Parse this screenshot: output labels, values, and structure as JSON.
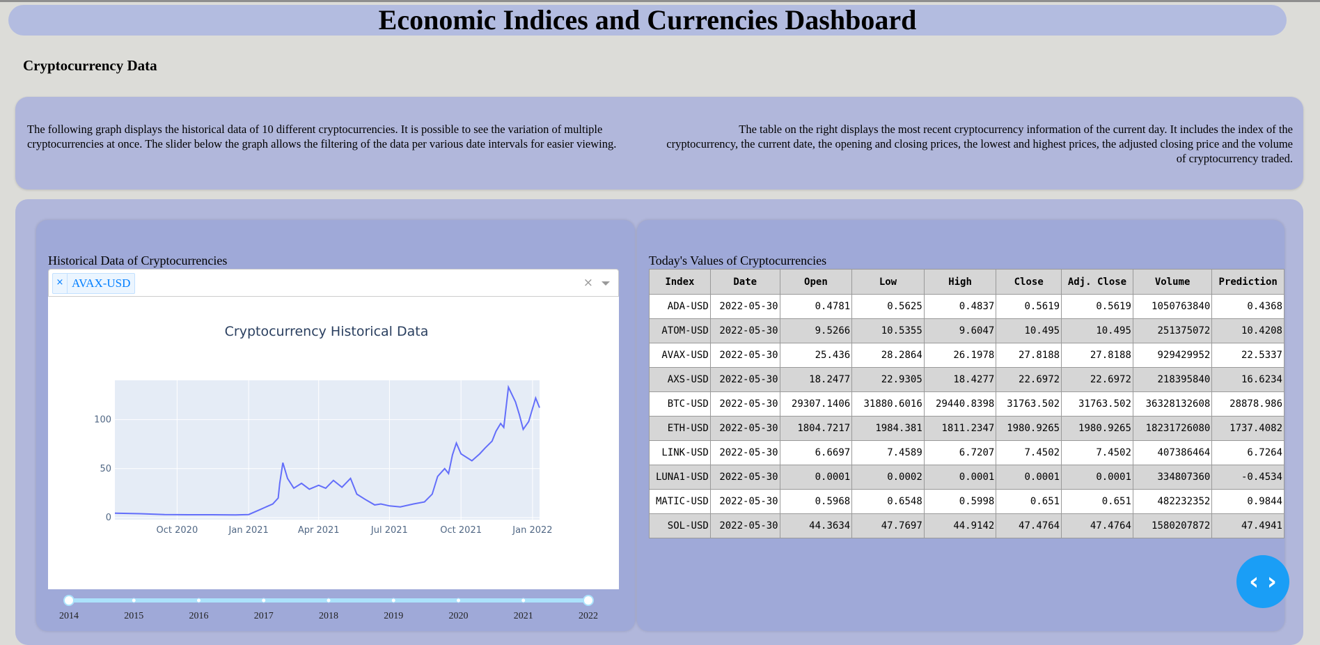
{
  "header": {
    "title": "Economic Indices and Currencies Dashboard"
  },
  "section": {
    "title": "Cryptocurrency Data"
  },
  "description": {
    "left": "The following graph displays the historical data of 10 different cryptocurrencies. It is possible to see the variation of multiple cryptocurrencies at once. The slider below the graph allows the filtering of the data per various date intervals for easier viewing.",
    "right": "The table on the right displays the most recent cryptocurrency information of the current day. It includes the index of the cryptocurrency, the current date, the opening and closing prices, the lowest and highest prices, the adjusted closing price and the volume of cryptocurrency traded."
  },
  "historical": {
    "title": "Historical Data of Cryptocurrencies",
    "dropdown": {
      "selected": [
        "AVAX-USD"
      ],
      "remove_glyph": "×",
      "clear_glyph": "×"
    }
  },
  "chart_data": {
    "type": "line",
    "title": "Cryptocurrency Historical Data",
    "xlabel": "",
    "ylabel": "",
    "x_ticks": [
      "Oct 2020",
      "Jan 2021",
      "Apr 2021",
      "Jul 2021",
      "Oct 2021",
      "Jan 2022"
    ],
    "y_ticks": [
      0,
      50,
      100
    ],
    "xlim": [
      "2020-07-13",
      "2022-01-10"
    ],
    "ylim": [
      -2,
      140
    ],
    "grid": true,
    "color": "#636efa",
    "series": [
      {
        "x": [
          "2020-07-13",
          "2020-08-15",
          "2020-09-15",
          "2020-10-15",
          "2020-11-15",
          "2020-12-15",
          "2021-01-01",
          "2021-01-15",
          "2021-02-01",
          "2021-02-08",
          "2021-02-10",
          "2021-02-14",
          "2021-02-20",
          "2021-02-28",
          "2021-03-10",
          "2021-03-20",
          "2021-04-01",
          "2021-04-10",
          "2021-04-20",
          "2021-05-01",
          "2021-05-12",
          "2021-05-20",
          "2021-06-01",
          "2021-06-12",
          "2021-06-20",
          "2021-07-01",
          "2021-07-15",
          "2021-08-01",
          "2021-08-15",
          "2021-08-25",
          "2021-09-01",
          "2021-09-10",
          "2021-09-15",
          "2021-09-20",
          "2021-09-25",
          "2021-10-01",
          "2021-10-15",
          "2021-10-25",
          "2021-11-01",
          "2021-11-10",
          "2021-11-15",
          "2021-11-21",
          "2021-11-25",
          "2021-12-01",
          "2021-12-10",
          "2021-12-15",
          "2021-12-20",
          "2021-12-27",
          "2022-01-05",
          "2022-01-10"
        ],
        "y": [
          4.5,
          4.0,
          3.2,
          3.0,
          3.0,
          2.8,
          3.2,
          8.0,
          14.0,
          20.0,
          35.0,
          56.0,
          40.0,
          30.0,
          35.0,
          29.0,
          33.0,
          30.0,
          38.0,
          31.0,
          40.0,
          24.0,
          18.0,
          13.0,
          14.0,
          12.0,
          11.0,
          14.0,
          16.0,
          24.0,
          42.0,
          50.0,
          45.0,
          64.0,
          76.0,
          65.0,
          58.0,
          65.0,
          71.0,
          78.0,
          88.0,
          96.0,
          92.0,
          133.0,
          118.0,
          105.0,
          90.0,
          98.0,
          122.0,
          112.0
        ]
      }
    ]
  },
  "slider": {
    "years": [
      "2014",
      "2015",
      "2016",
      "2017",
      "2018",
      "2019",
      "2020",
      "2021",
      "2022"
    ]
  },
  "today": {
    "title": "Today's Values of Cryptocurrencies",
    "columns": [
      "Index",
      "Date",
      "Open",
      "Low",
      "High",
      "Close",
      "Adj. Close",
      "Volume",
      "Prediction"
    ],
    "rows": [
      [
        "ADA-USD",
        "2022-05-30",
        "0.4781",
        "0.5625",
        "0.4837",
        "0.5619",
        "0.5619",
        "1050763840",
        "0.4368"
      ],
      [
        "ATOM-USD",
        "2022-05-30",
        "9.5266",
        "10.5355",
        "9.6047",
        "10.495",
        "10.495",
        "251375072",
        "10.4208"
      ],
      [
        "AVAX-USD",
        "2022-05-30",
        "25.436",
        "28.2864",
        "26.1978",
        "27.8188",
        "27.8188",
        "929429952",
        "22.5337"
      ],
      [
        "AXS-USD",
        "2022-05-30",
        "18.2477",
        "22.9305",
        "18.4277",
        "22.6972",
        "22.6972",
        "218395840",
        "16.6234"
      ],
      [
        "BTC-USD",
        "2022-05-30",
        "29307.1406",
        "31880.6016",
        "29440.8398",
        "31763.502",
        "31763.502",
        "36328132608",
        "28878.986"
      ],
      [
        "ETH-USD",
        "2022-05-30",
        "1804.7217",
        "1984.381",
        "1811.2347",
        "1980.9265",
        "1980.9265",
        "18231726080",
        "1737.4082"
      ],
      [
        "LINK-USD",
        "2022-05-30",
        "6.6697",
        "7.4589",
        "6.7207",
        "7.4502",
        "7.4502",
        "407386464",
        "6.7264"
      ],
      [
        "LUNA1-USD",
        "2022-05-30",
        "0.0001",
        "0.0002",
        "0.0001",
        "0.0001",
        "0.0001",
        "334807360",
        "-0.4534"
      ],
      [
        "MATIC-USD",
        "2022-05-30",
        "0.5968",
        "0.6548",
        "0.5998",
        "0.651",
        "0.651",
        "482232352",
        "0.9844"
      ],
      [
        "SOL-USD",
        "2022-05-30",
        "44.3634",
        "47.7697",
        "44.9142",
        "47.4764",
        "47.4764",
        "1580207872",
        "47.4941"
      ]
    ]
  },
  "fab": {
    "label": "‹ ›"
  }
}
